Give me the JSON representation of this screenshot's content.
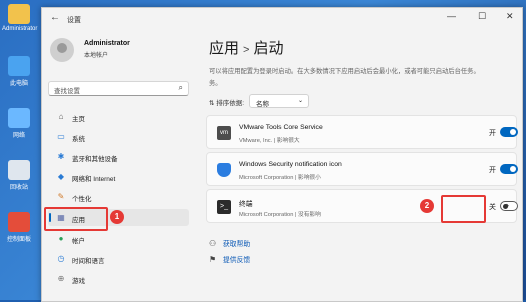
{
  "desktop": {
    "icons": [
      {
        "label": "Administrator",
        "color": "#f2c24c"
      },
      {
        "label": "此电脑",
        "color": "#4aa3f0"
      },
      {
        "label": "网络",
        "color": "#6bb8ff"
      },
      {
        "label": "回收站",
        "color": "#dfe6ee"
      },
      {
        "label": "控制面板",
        "color": "#e44d3a"
      }
    ]
  },
  "window": {
    "title": "设置",
    "controls": [
      "—",
      "☐",
      "✕"
    ]
  },
  "sidebar": {
    "user_name": "Administrator",
    "user_sub": "本地帐户",
    "search_placeholder": "查找设置",
    "items": [
      {
        "label": "主页",
        "icon": "home-icon",
        "glyph": "⌂",
        "color": "#555"
      },
      {
        "label": "系统",
        "icon": "system-icon",
        "glyph": "▭",
        "color": "#2a7bd4"
      },
      {
        "label": "蓝牙和其他设备",
        "icon": "bluetooth-icon",
        "glyph": "✱",
        "color": "#2a7bd4"
      },
      {
        "label": "网络和 Internet",
        "icon": "network-icon",
        "glyph": "◆",
        "color": "#2a7bd4"
      },
      {
        "label": "个性化",
        "icon": "brush-icon",
        "glyph": "✎",
        "color": "#d07a2a"
      },
      {
        "label": "应用",
        "icon": "apps-icon",
        "glyph": "▦",
        "color": "#5a6aa8"
      },
      {
        "label": "帐户",
        "icon": "account-icon",
        "glyph": "●",
        "color": "#2aa05a"
      },
      {
        "label": "时间和语言",
        "icon": "clock-icon",
        "glyph": "◷",
        "color": "#2a7bd4"
      },
      {
        "label": "游戏",
        "icon": "game-icon",
        "glyph": "⊕",
        "color": "#777"
      }
    ],
    "active_index": 5
  },
  "main": {
    "breadcrumb_parent": "应用",
    "breadcrumb_sep": ">",
    "breadcrumb_current": "启动",
    "desc_line1": "可以将应用配置为登录时启动。在大多数情况下应用启动后会最小化，或者可能只启动后台任务。",
    "desc_line2": "务。",
    "sort_label": "排序依据:",
    "sort_value": "名称",
    "apps": [
      {
        "name": "VMware Tools Core Service",
        "publisher": "VMware, Inc.  |  影响很大",
        "state": "开",
        "on": true,
        "icon_color": "#4d4d4d"
      },
      {
        "name": "Windows Security notification icon",
        "publisher": "Microsoft Corporation  |  影响很小",
        "state": "开",
        "on": true,
        "icon_color": "#2b7de0"
      },
      {
        "name": "终端",
        "publisher": "Microsoft Corporation  |  没有影响",
        "state": "关",
        "on": false,
        "icon_color": "#2b2b2b"
      }
    ],
    "links": [
      "获取帮助",
      "提供反馈"
    ]
  },
  "annotations": {
    "badge1": "1",
    "badge2": "2"
  }
}
